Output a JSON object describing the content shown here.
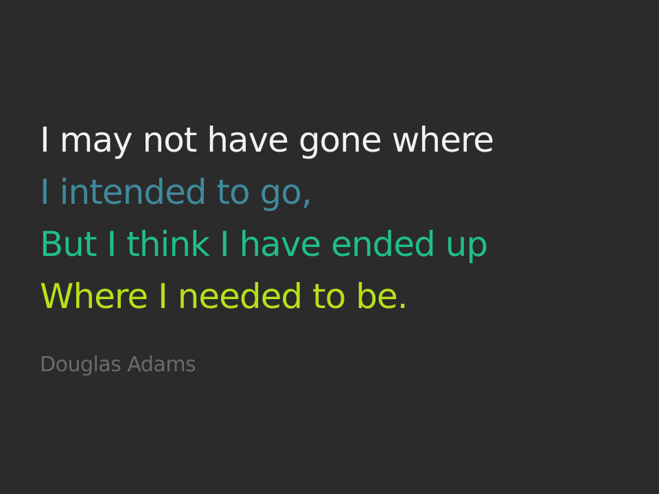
{
  "quote": {
    "lines": [
      {
        "text": "I may not have gone where",
        "color": "#f2f2f2"
      },
      {
        "text": "I intended to go,",
        "color": "#3f8a9c"
      },
      {
        "text": "But I think I have ended up",
        "color": "#1fbf8a"
      },
      {
        "text": "Where I needed to be.",
        "color": "#b8e01a"
      }
    ]
  },
  "author": {
    "name": "Douglas Adams",
    "color": "#6b6b6b"
  },
  "background_color": "#2b2b2b"
}
